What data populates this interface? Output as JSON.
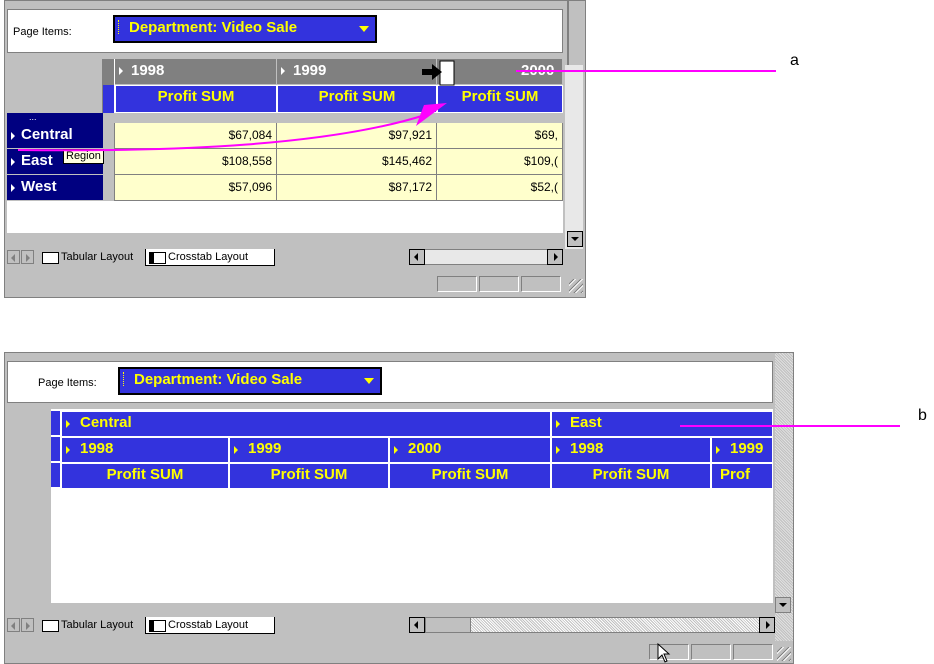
{
  "page_items": {
    "label": "Page Items:",
    "dropdown": "Department: Video Sale"
  },
  "panel_a": {
    "years": [
      "1998",
      "1999",
      "2000"
    ],
    "measures": [
      "Profit SUM",
      "Profit SUM",
      "Profit SUM"
    ],
    "rows": [
      {
        "region": "Central",
        "values": [
          "$67,084",
          "$97,921",
          "$69,"
        ]
      },
      {
        "region": "East",
        "values": [
          "$108,558",
          "$145,462",
          "$109,("
        ]
      },
      {
        "region": "West",
        "values": [
          "$57,096",
          "$87,172",
          "$52,("
        ]
      }
    ],
    "tooltip": "Region",
    "dots": "..."
  },
  "panel_b": {
    "regions": [
      "Central",
      "East"
    ],
    "years": [
      "1998",
      "1999",
      "2000",
      "1998",
      "1999"
    ],
    "measures": [
      "Profit SUM",
      "Profit SUM",
      "Profit SUM",
      "Profit SUM",
      "Prof"
    ]
  },
  "tabs": {
    "tabular": "Tabular Layout",
    "crosstab": "Crosstab Layout"
  },
  "callouts": {
    "a": "a",
    "b": "b"
  },
  "colors": {
    "header_blue": "#3333dd",
    "header_text": "#ffff00",
    "row_navy": "#000080",
    "data_bg": "#ffffcc",
    "callout": "#ff00ff"
  },
  "icons": [
    "dropdown-arrow-icon",
    "drag-arrow-icon",
    "table-icon",
    "crosstab-icon",
    "mouse-cursor-icon",
    "resize-grip-icon"
  ]
}
